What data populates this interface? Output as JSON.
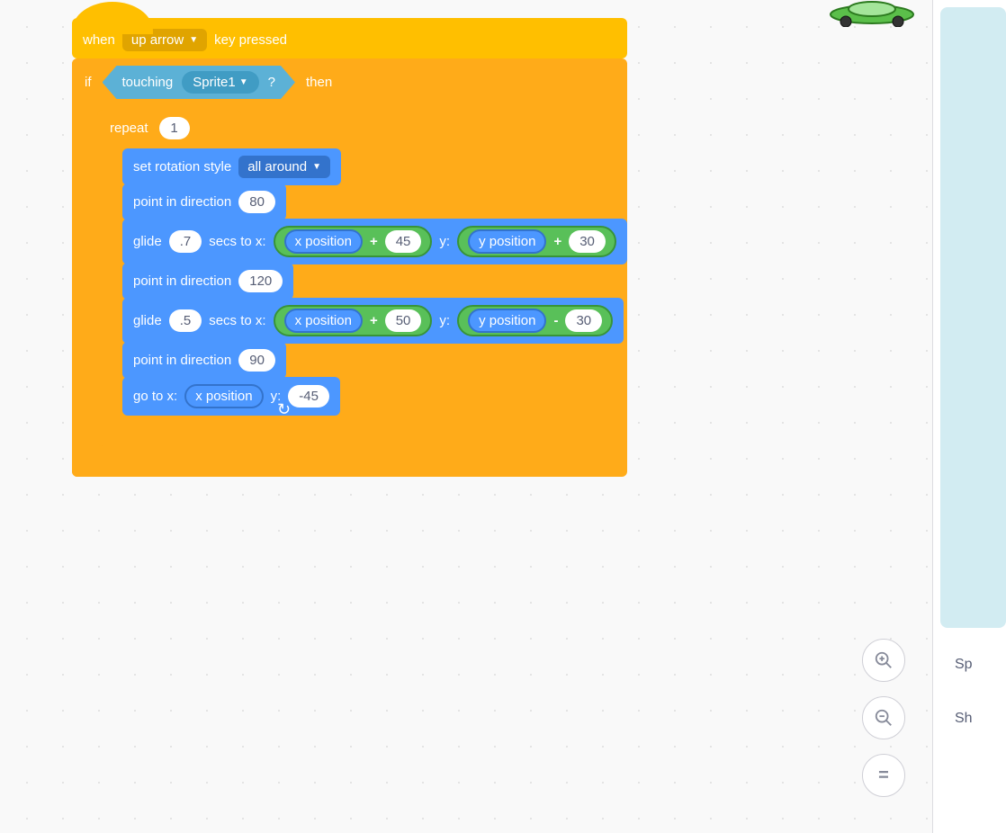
{
  "hat": {
    "when": "when",
    "key": "up arrow",
    "key_pressed": "key pressed"
  },
  "if_block": {
    "if": "if",
    "then": "then",
    "touching": "touching",
    "target": "Sprite1",
    "q": "?"
  },
  "repeat": {
    "label": "repeat",
    "count": "1"
  },
  "b1": {
    "label": "set rotation style",
    "style": "all around"
  },
  "b2": {
    "label": "point in direction",
    "val": "80"
  },
  "b3": {
    "glide": "glide",
    "secs": ".7",
    "secs_to_x": "secs to x:",
    "xpos": "x position",
    "plus1": "+",
    "v1": "45",
    "y": "y:",
    "ypos": "y position",
    "plus2": "+",
    "v2": "30"
  },
  "b4": {
    "label": "point in direction",
    "val": "120"
  },
  "b5": {
    "glide": "glide",
    "secs": ".5",
    "secs_to_x": "secs to x:",
    "xpos": "x position",
    "plus1": "+",
    "v1": "50",
    "y": "y:",
    "ypos": "y position",
    "minus": "-",
    "v2": "30"
  },
  "b6": {
    "label": "point in direction",
    "val": "90"
  },
  "b7": {
    "goto": "go to x:",
    "xpos": "x position",
    "y": "y:",
    "v": "-45"
  },
  "sidebar": {
    "sprite_label_1": "Sp",
    "sprite_label_2": "Sh"
  }
}
